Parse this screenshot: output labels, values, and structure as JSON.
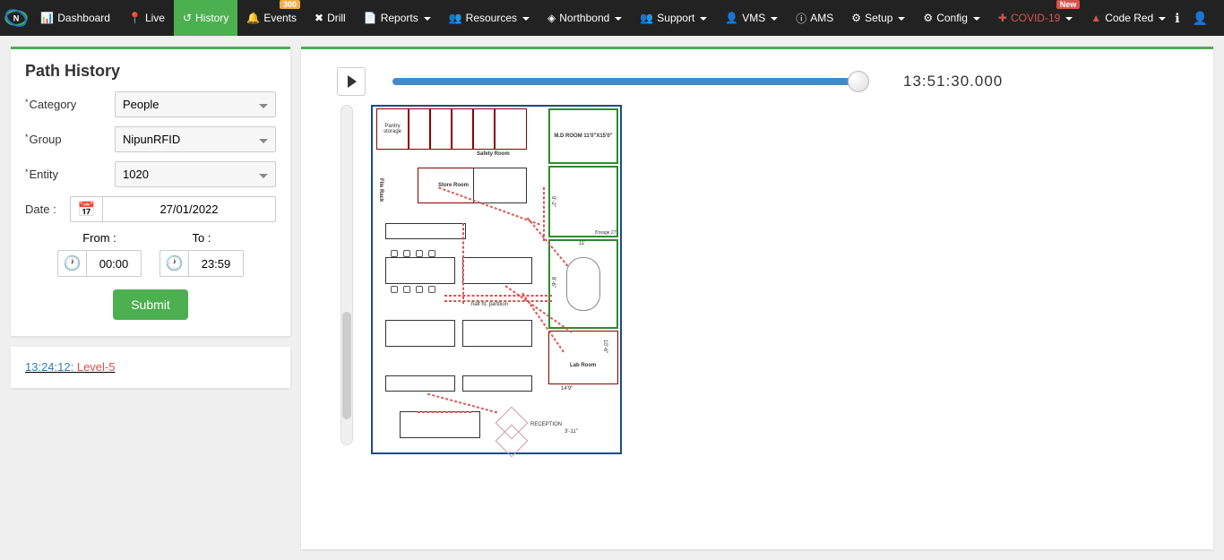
{
  "nav": {
    "dashboard": "Dashboard",
    "live": "Live",
    "history": "History",
    "events": "Events",
    "events_badge": "300",
    "drill": "Drill",
    "reports": "Reports",
    "resources": "Resources",
    "northbond": "Northbond",
    "support": "Support",
    "vms": "VMS",
    "ams": "AMS",
    "setup": "Setup",
    "config": "Config",
    "covid": "COVID-19",
    "covid_badge": "New",
    "code_red": "Code Red"
  },
  "sidebar": {
    "title": "Path History",
    "category_label": "Category",
    "category_value": "People",
    "group_label": "Group",
    "group_value": "NipunRFID",
    "entity_label": "Entity",
    "entity_value": "1020",
    "date_label": "Date :",
    "date_value": "27/01/2022",
    "from_label": "From :",
    "from_value": "00:00",
    "to_label": "To :",
    "to_value": "23:59",
    "submit": "Submit"
  },
  "level": {
    "time": "13:24:12",
    "name": "Level-5"
  },
  "player": {
    "time": "13:51:30.000"
  },
  "floorplan": {
    "pantry": "Pantry storage",
    "safety": "Safety Room",
    "md": "M.D ROOM 11'0\"X15'0\"",
    "store": "Store Room",
    "lab": "Lab Room",
    "reception": "RECEPTION",
    "partition": "half ht. partition",
    "dim1": "9'-2\"",
    "dim2": "11'",
    "dim3": "8'-6\"",
    "dim4": "10'-6\"",
    "dim5": "3'-11\"",
    "dim6": "14'9\"",
    "dim7": "8'orage 27'",
    "filerack": "File Rack"
  }
}
